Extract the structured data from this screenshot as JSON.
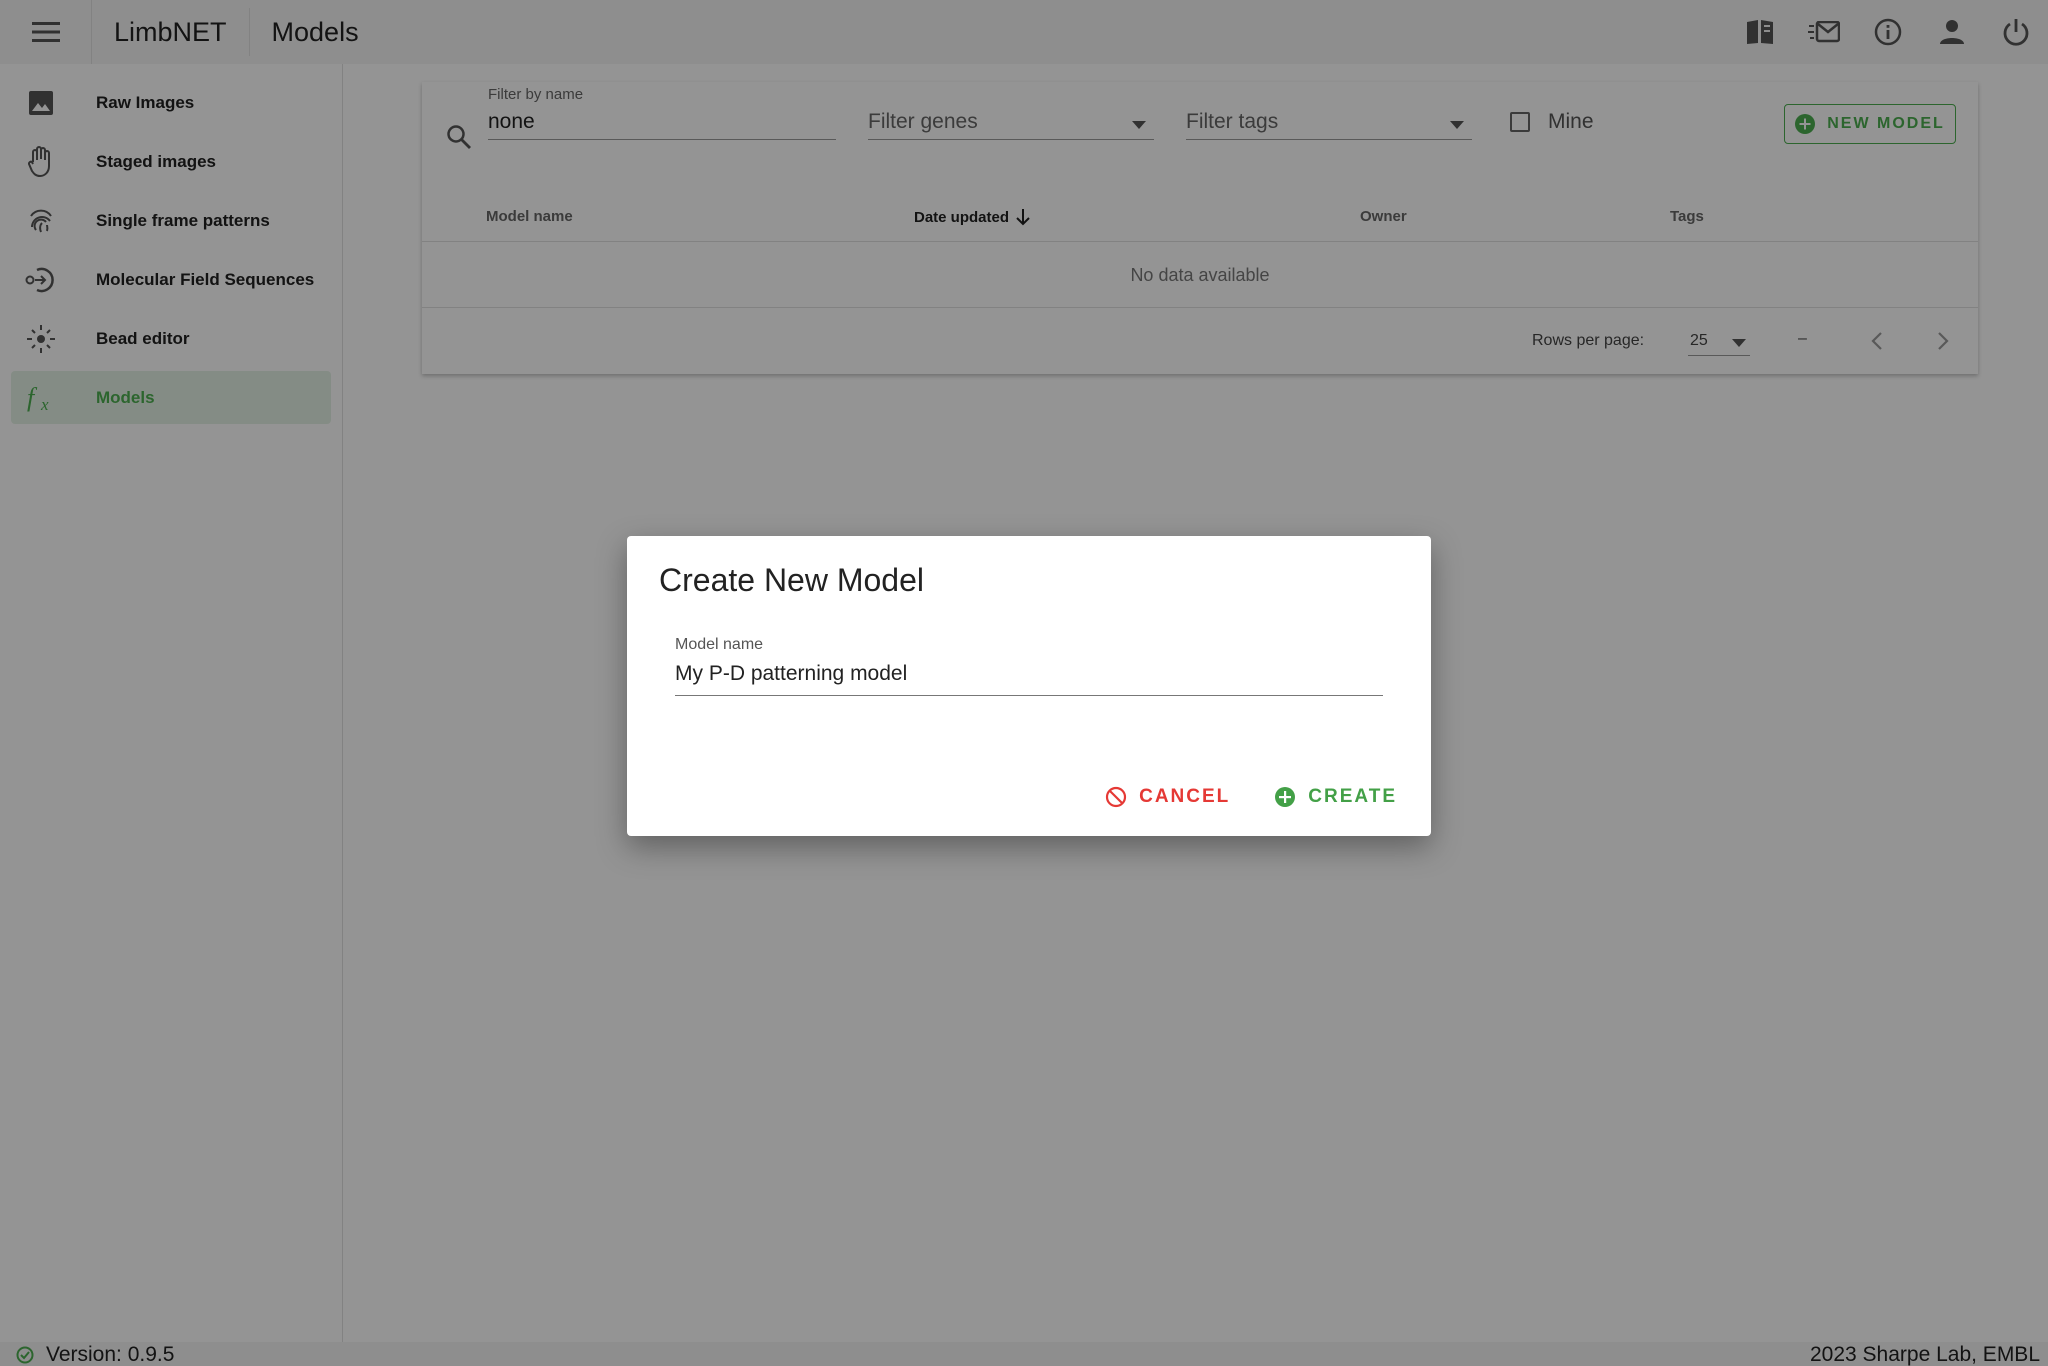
{
  "appbar": {
    "brand": "LimbNET",
    "page_title": "Models",
    "actions": [
      "book-open-icon",
      "email-fast-icon",
      "information-icon",
      "account-icon",
      "power-icon"
    ]
  },
  "sidebar": {
    "items": [
      {
        "label": "Raw Images",
        "icon": "image-icon"
      },
      {
        "label": "Staged images",
        "icon": "hand-icon"
      },
      {
        "label": "Single frame patterns",
        "icon": "fingerprint-icon"
      },
      {
        "label": "Molecular Field Sequences",
        "icon": "sequence-icon"
      },
      {
        "label": "Bead editor",
        "icon": "bead-icon"
      },
      {
        "label": "Models",
        "icon": "function-icon",
        "active": true
      }
    ]
  },
  "filters": {
    "name_label": "Filter by name",
    "name_value": "none",
    "genes_placeholder": "Filter genes",
    "tags_placeholder": "Filter tags",
    "mine_label": "Mine",
    "new_model_label": "NEW MODEL"
  },
  "table": {
    "columns": [
      "Model name",
      "Date updated",
      "Owner",
      "Tags"
    ],
    "sorted_column": "Date updated",
    "empty_text": "No data available"
  },
  "pager": {
    "rows_per_page_label": "Rows per page:",
    "rows_per_page": "25",
    "range": "–"
  },
  "footer": {
    "version": "Version: 0.9.5",
    "copyright": "2023 Sharpe Lab, EMBL"
  },
  "dialog": {
    "title": "Create New Model",
    "field_label": "Model name",
    "field_value": "My P-D patterning model",
    "cancel_label": "CANCEL",
    "create_label": "CREATE"
  },
  "colors": {
    "accent_green": "#4caf50",
    "cancel_red": "#e53935",
    "active_bg": "#e4f2e5"
  }
}
